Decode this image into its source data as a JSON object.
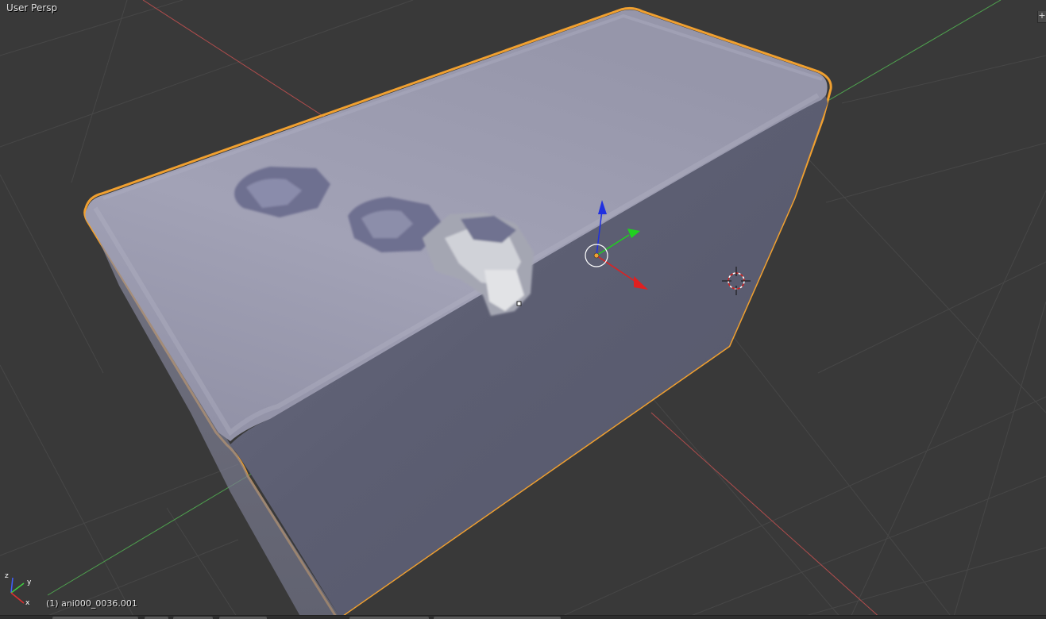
{
  "viewport": {
    "view_name": "User Persp",
    "object_info": "(1) ani000_0036.001"
  },
  "axes_widget": {
    "x_label": "x",
    "y_label": "y",
    "z_label": "z"
  },
  "icons": {
    "corner_expand": "plus-icon",
    "transform_gizmo": "transform-gizmo-icon",
    "cursor": "3d-cursor-icon"
  },
  "colors": {
    "background": "#393939",
    "grid": "#474747",
    "x_axis": "#b24d4d",
    "y_axis": "#4fa34f",
    "mesh_top": "#9a9aae",
    "mesh_side": "#5e6073",
    "selection_outline": "#f0a030",
    "gizmo_x": "#e02020",
    "gizmo_y": "#20d020",
    "gizmo_z": "#2030e0"
  }
}
